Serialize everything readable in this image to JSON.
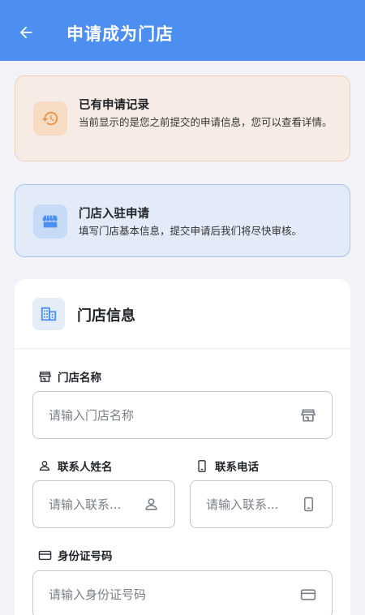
{
  "appbar": {
    "title": "申请成为门店",
    "back_icon": "arrow-left-icon",
    "background_color": "#4c8ff0"
  },
  "history_notice": {
    "icon": "history-icon",
    "title": "已有申请记录",
    "description": "当前显示的是您之前提交的申请信息，您可以查看详情。"
  },
  "join_notice": {
    "icon": "store-icon",
    "title": "门店入驻申请",
    "description": "填写门店基本信息，提交申请后我们将尽快审核。"
  },
  "store_info": {
    "icon": "building-icon",
    "title": "门店信息",
    "fields": {
      "store_name": {
        "label": "门店名称",
        "placeholder": "请输入门店名称",
        "value": "",
        "icon": "storefront-icon"
      },
      "contact_name": {
        "label": "联系人姓名",
        "placeholder": "请输入联系...",
        "value": "",
        "icon": "person-icon"
      },
      "contact_phone": {
        "label": "联系电话",
        "placeholder": "请输入联系...",
        "value": "",
        "icon": "phone-icon"
      },
      "id_number": {
        "label": "身份证号码",
        "placeholder": "请输入身份证号码",
        "value": "",
        "icon": "card-icon"
      }
    }
  },
  "colors": {
    "accent": "#4c8ff0",
    "history_bg": "#f7ece5",
    "history_icon": "#e8934a",
    "join_bg": "#e3ebf8",
    "join_icon": "#4c8ff0"
  }
}
